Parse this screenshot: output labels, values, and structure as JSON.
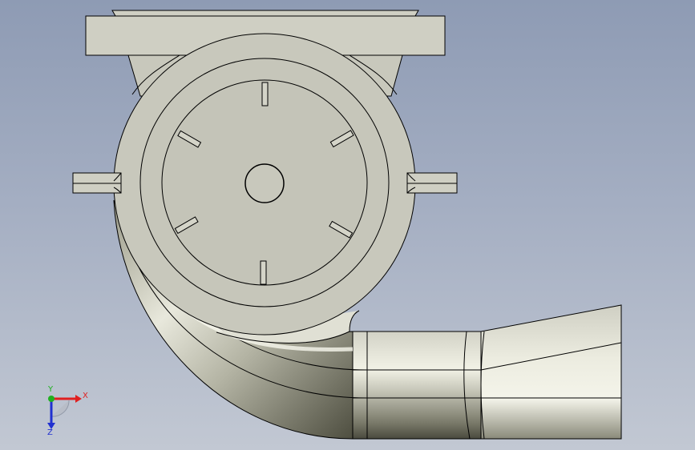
{
  "viewport": {
    "background_top": "#8e9bb4",
    "background_bottom": "#c2c8d3"
  },
  "model": {
    "face_color": "#c8c8bc",
    "edge_color": "#000000",
    "highlight_color": "#f4f4ea",
    "shadow_color": "#3e3e34"
  },
  "triad": {
    "x_label": "X",
    "y_label": "Y",
    "z_label": "Z",
    "x_color": "#e02020",
    "y_color": "#20b020",
    "z_color": "#2030d0"
  }
}
